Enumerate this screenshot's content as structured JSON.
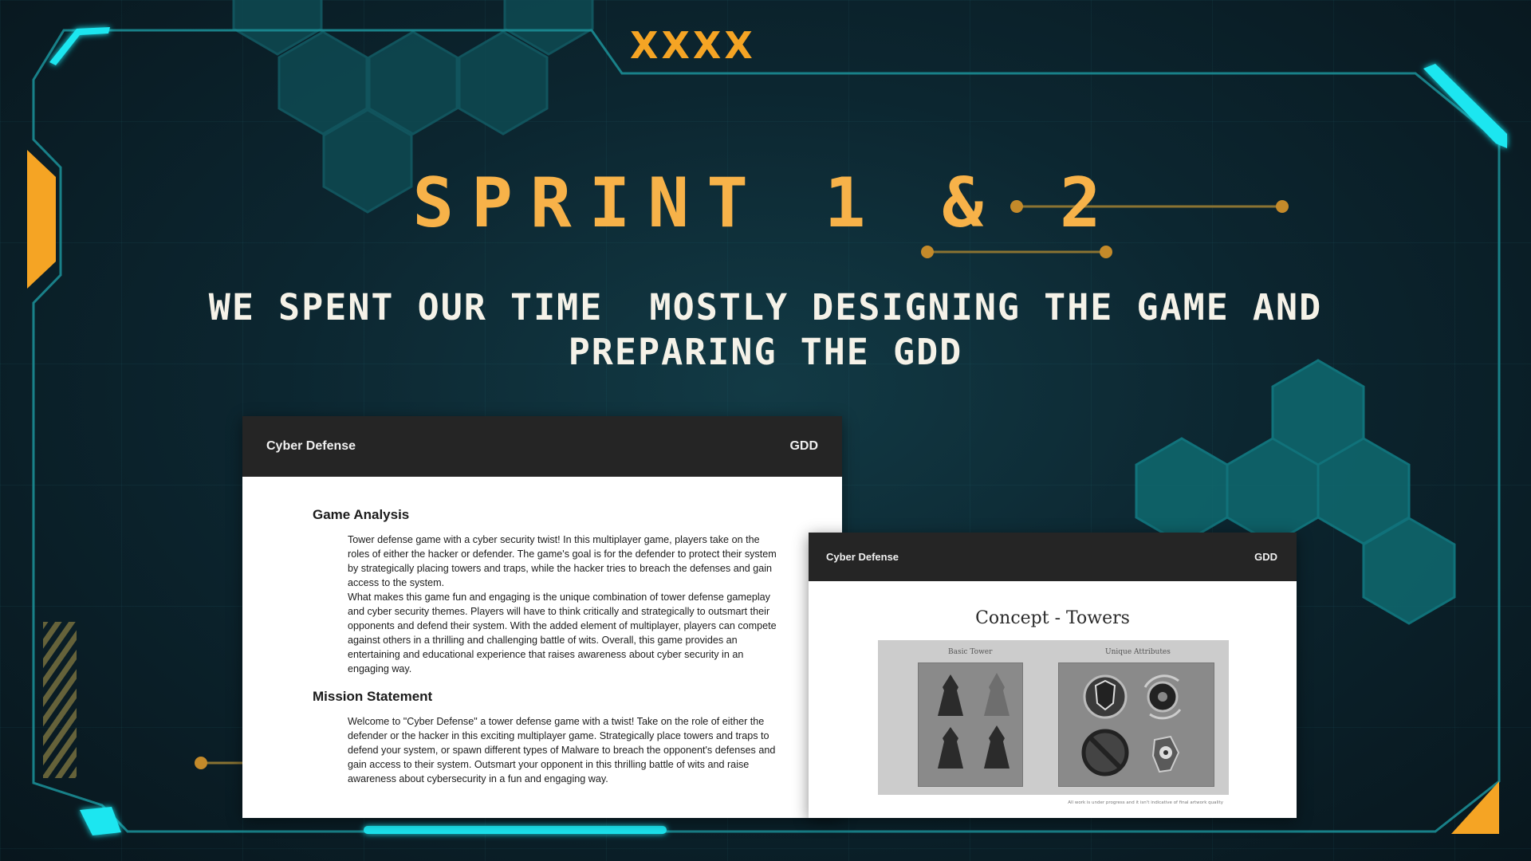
{
  "colors": {
    "accent_orange": "#f5a424",
    "title_orange": "#f7b249",
    "frame_teal": "#1b8c93",
    "glow_cyan": "#1ee6f0",
    "hex_teal": "#0f5f66"
  },
  "top_marks": "XXXX",
  "title": "SPRINT 1 & 2",
  "subtitle_line1": "WE SPENT OUR TIME  MOSTLY DESIGNING THE GAME AND",
  "subtitle_line2": "PREPARING THE GDD",
  "doc1": {
    "header_left": "Cyber Defense",
    "header_right": "GDD",
    "section1_title": "Game Analysis",
    "section1_p1": "Tower defense game with a cyber security twist! In this multiplayer game, players take on the roles of either the hacker or defender. The game's goal is for the defender to protect their system by strategically placing towers and traps, while the hacker tries to breach the defenses and gain access to the system.",
    "section1_p2": "What makes this game fun and engaging is the unique combination of tower defense gameplay and cyber security themes. Players will have to think critically and strategically to outsmart their opponents and defend their system. With the added element of multiplayer, players can compete against others in a thrilling and challenging battle of wits. Overall, this game provides an entertaining and educational experience that raises awareness about cyber security in an engaging way.",
    "section2_title": "Mission Statement",
    "section2_p1": "Welcome to \"Cyber Defense\" a tower defense game with a twist! Take on the role of either the defender or the hacker in this exciting multiplayer game. Strategically place towers and traps to defend your system, or spawn different types of Malware to breach the opponent's defenses and gain access to their system. Outsmart your opponent in this thrilling battle of wits and raise awareness about cybersecurity in a fun and engaging way."
  },
  "doc2": {
    "header_left": "Cyber Defense",
    "header_right": "GDD",
    "concept_title": "Concept - Towers",
    "label_basic": "Basic Tower",
    "label_unique": "Unique Attributes",
    "footnote": "All work is under progress and it isn't indicative of final artwork quality"
  }
}
